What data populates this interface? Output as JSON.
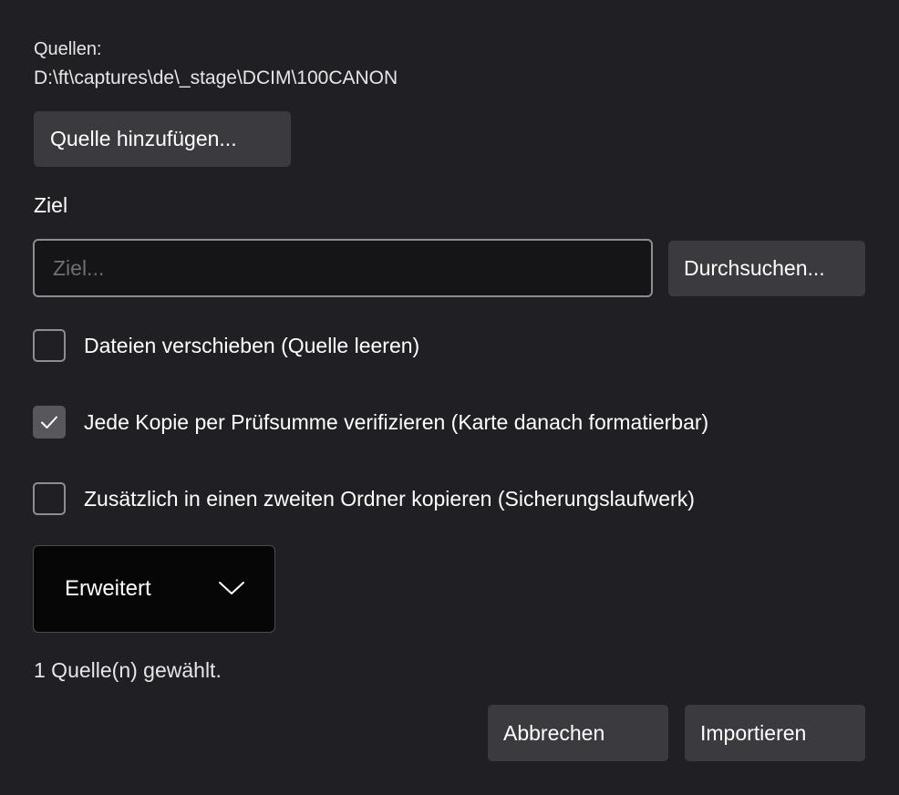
{
  "sources": {
    "label": "Quellen:",
    "paths": [
      "D:\\ft\\captures\\de\\_stage\\DCIM\\100CANON"
    ],
    "add_button_label": "Quelle hinzufügen..."
  },
  "destination": {
    "label": "Ziel",
    "value": "",
    "placeholder": "Ziel...",
    "browse_button_label": "Durchsuchen..."
  },
  "options": [
    {
      "label": "Dateien verschieben (Quelle leeren)",
      "checked": false
    },
    {
      "label": "Jede Kopie per Prüfsumme verifizieren (Karte danach formatierbar)",
      "checked": true
    },
    {
      "label": "Zusätzlich in einen zweiten Ordner kopieren (Sicherungslaufwerk)",
      "checked": false
    }
  ],
  "advanced": {
    "label": "Erweitert",
    "expanded": false,
    "icon": "chevron-down-icon"
  },
  "status": "1 Quelle(n) gewählt.",
  "footer": {
    "cancel_label": "Abbrechen",
    "import_label": "Importieren"
  },
  "colors": {
    "background": "#202024",
    "button": "#3b3b3f",
    "checked_box": "#58585c",
    "input_background": "#151518",
    "border": "#8e8e92"
  }
}
